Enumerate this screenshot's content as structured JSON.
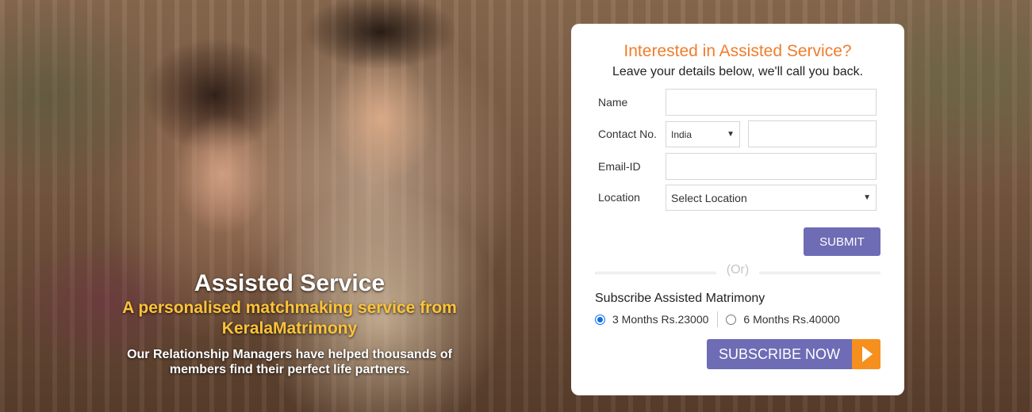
{
  "hero": {
    "title": "Assisted Service",
    "subtitle_line1": "A personalised matchmaking service from",
    "subtitle_line2": "KeralaMatrimony",
    "description_line1": "Our Relationship Managers have helped thousands of",
    "description_line2": "members find their perfect life partners."
  },
  "form": {
    "title": "Interested in Assisted Service?",
    "subtitle": "Leave your details below, we'll call you back.",
    "name_label": "Name",
    "name_value": "",
    "contact_label": "Contact No.",
    "country_selected": "India",
    "contact_value": "",
    "email_label": "Email-ID",
    "email_value": "",
    "location_label": "Location",
    "location_selected": "Select Location",
    "submit_label": "SUBMIT",
    "or_text": "(Or)",
    "subscribe_title": "Subscribe Assisted Matrimony",
    "plans": [
      {
        "label": "3 Months Rs.23000",
        "selected": true
      },
      {
        "label": "6 Months Rs.40000",
        "selected": false
      }
    ],
    "subscribe_label": "SUBSCRIBE NOW"
  },
  "colors": {
    "accent_orange": "#f07d2b",
    "button_purple": "#6d6cb5",
    "subscribe_arrow": "#f5901e",
    "hero_subtitle": "#ffc438"
  },
  "icons": {
    "dropdown": "chevron-down-icon",
    "subscribe_arrow": "play-arrow-icon"
  }
}
